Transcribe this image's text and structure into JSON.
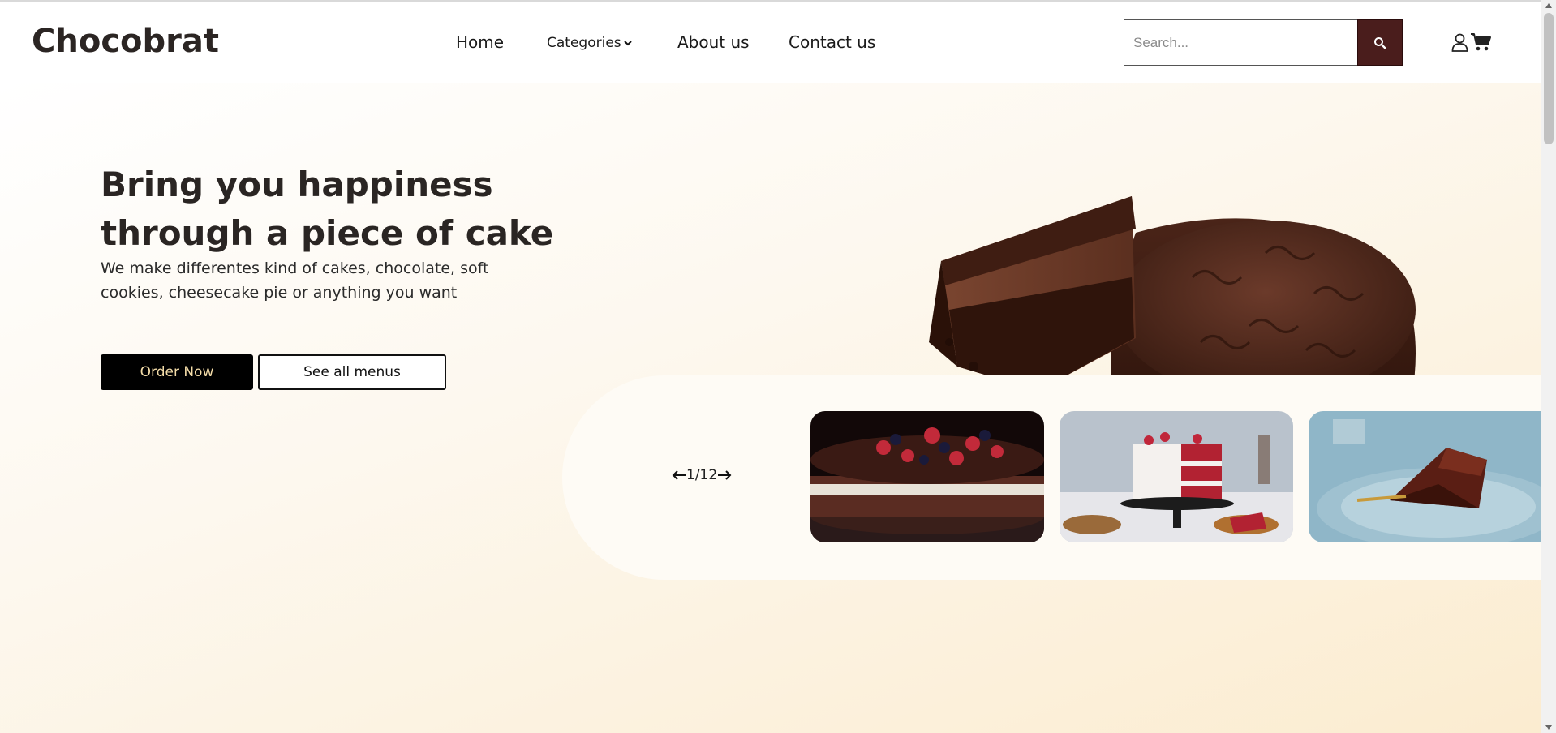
{
  "header": {
    "logo": "Chocobrat",
    "nav": {
      "home": "Home",
      "categories": "Categories",
      "about": "About us",
      "contact": "Contact us"
    },
    "search": {
      "placeholder": "Search...",
      "value": ""
    }
  },
  "hero": {
    "title": "Bring you happiness through a piece of cake",
    "subtitle": "We make differentes kind of cakes, chocolate, soft cookies, cheesecake pie or anything you want",
    "order_button": "Order Now",
    "menus_button": "See all menus"
  },
  "carousel": {
    "counter": "1/12",
    "thumbnails": [
      {
        "alt": "chocolate berry layer cake"
      },
      {
        "alt": "red velvet cake on stand"
      },
      {
        "alt": "chocolate cake slice on plate"
      }
    ]
  },
  "icons": {
    "search": "search-icon",
    "user": "user-icon",
    "cart": "cart-icon",
    "chevron": "chevron-down-icon",
    "prev": "arrow-left-icon",
    "next": "arrow-right-icon"
  },
  "colors": {
    "brand_dark": "#4a1d1c",
    "button_black": "#000000",
    "button_text": "#f3dca8",
    "hero_bg_warm": "#fbecd0"
  }
}
